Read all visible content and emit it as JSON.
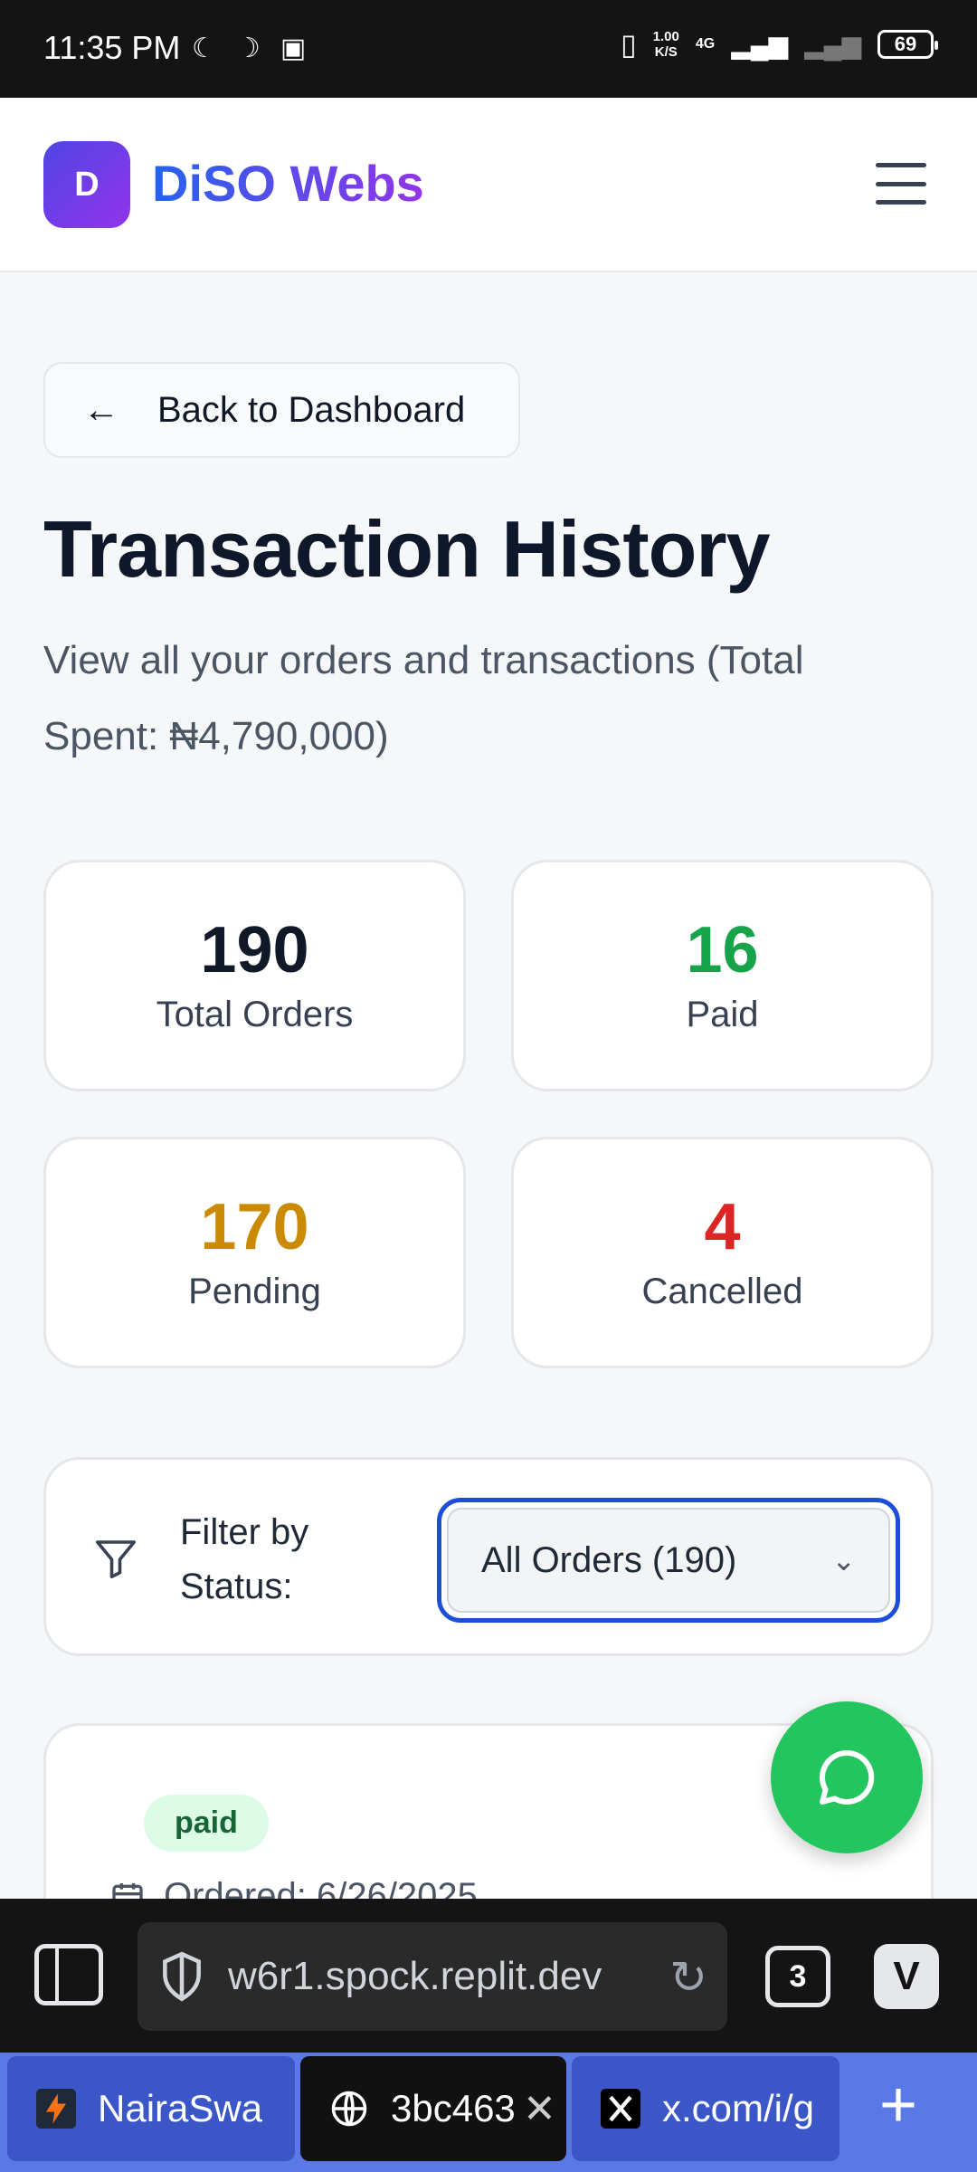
{
  "status_bar": {
    "time": "11:35 PM",
    "speed_value": "1.00",
    "speed_unit": "K/S",
    "network": "4G",
    "battery": "69"
  },
  "header": {
    "logo_letter": "D",
    "brand": "DiSO Webs"
  },
  "back_button": {
    "label": "Back to Dashboard"
  },
  "page": {
    "title": "Transaction History",
    "subtitle": "View all your orders and transactions (Total Spent: ₦4,790,000)"
  },
  "stats": [
    {
      "value": "190",
      "label": "Total Orders",
      "color": "#111827"
    },
    {
      "value": "16",
      "label": "Paid",
      "color": "#16a34a"
    },
    {
      "value": "170",
      "label": "Pending",
      "color": "#ca8a04"
    },
    {
      "value": "4",
      "label": "Cancelled",
      "color": "#dc2626"
    }
  ],
  "filter": {
    "label": "Filter by Status:",
    "selected": "All Orders (190)"
  },
  "order": {
    "status": "paid",
    "ordered": "Ordered: 6/26/2025"
  },
  "browser": {
    "url": "w6r1.spock.replit.dev",
    "tab_count": "3",
    "tabs": [
      {
        "label": "NairaSwa",
        "icon": "nairaswap-favicon"
      },
      {
        "label": "3bc463",
        "icon": "globe-icon"
      },
      {
        "label": "x.com/i/g",
        "icon": "x-logo-icon"
      }
    ]
  },
  "colors": {
    "accent": "#1d4ed8",
    "brand_start": "#2563eb",
    "brand_end": "#9333ea",
    "whatsapp": "#22c55e"
  }
}
